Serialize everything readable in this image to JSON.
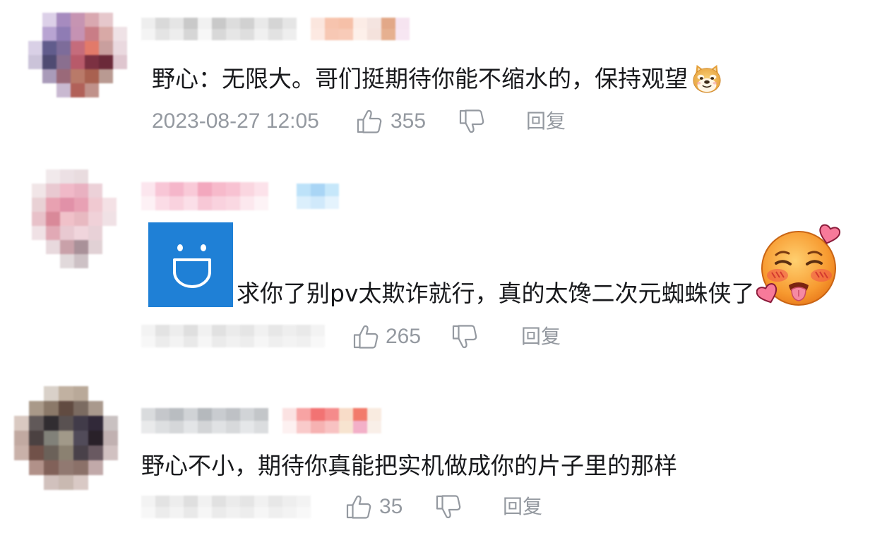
{
  "colors": {
    "text": "#18191c",
    "meta": "#9499a0",
    "sticker_bg": "#1f80d6"
  },
  "icons": {
    "like": "thumbs-up-icon",
    "dislike": "thumbs-down-icon"
  },
  "labels": {
    "reply": "回复"
  },
  "comments": [
    {
      "content": "野心：无限大。哥们挺期待你能不缩水的，保持观望",
      "emote_icon": "doge-emoji-icon",
      "time": "2023-08-27 12:05",
      "likes": 355
    },
    {
      "sticker_icon": "smiley-sticker-icon",
      "content": "求你了别pv太欺诈就行，真的太馋二次元蜘蛛侠了",
      "emote_icon": "blushing-face-emoji-icon",
      "likes": 265
    },
    {
      "content": "野心不小，期待你真能把实机做成你的片子里的那样",
      "likes": 35
    }
  ]
}
